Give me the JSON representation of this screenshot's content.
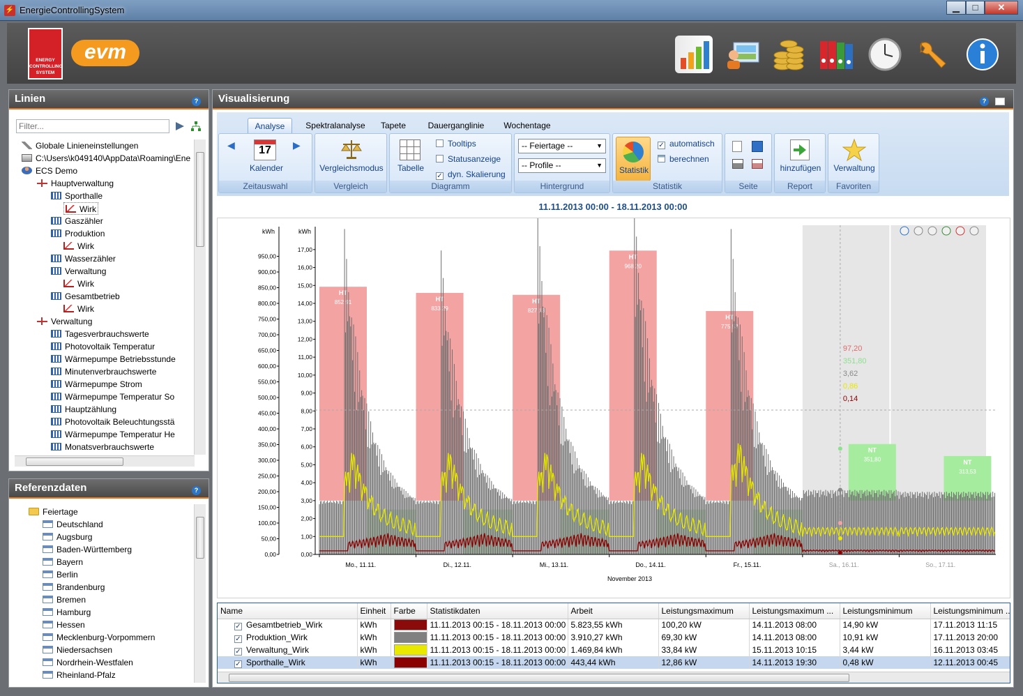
{
  "window": {
    "title": "EnergieControllingSystem",
    "btn_min": "▁",
    "btn_max": "□",
    "btn_close": "✕"
  },
  "header": {
    "ecs_logo": "ENERGY CONTROLLING SYSTEM",
    "evm_logo": "evm"
  },
  "lines_panel": {
    "title": "Linien",
    "filter_placeholder": "Filter...",
    "tree": [
      {
        "label": "Globale Linieneinstellungen",
        "icon": "wrench-icon",
        "level": 0
      },
      {
        "label": "C:\\Users\\k049140\\AppData\\Roaming\\Ene",
        "icon": "drive-icon",
        "level": 0
      },
      {
        "label": "ECS Demo",
        "icon": "user-icon",
        "level": 1
      },
      {
        "label": "Hauptverwaltung",
        "icon": "tree-icon",
        "level": 2
      },
      {
        "label": "Sporthalle",
        "icon": "meter-icon",
        "level": 3
      },
      {
        "label": "Wirk",
        "icon": "chart-icon",
        "level": 4
      },
      {
        "label": "Gaszähler",
        "icon": "meter-icon",
        "level": 3
      },
      {
        "label": "Produktion",
        "icon": "meter-icon",
        "level": 3
      },
      {
        "label": "Wirk",
        "icon": "chart-icon",
        "level": 4
      },
      {
        "label": "Wasserzähler",
        "icon": "meter-icon",
        "level": 3
      },
      {
        "label": "Verwaltung",
        "icon": "meter-icon",
        "level": 3
      },
      {
        "label": "Wirk",
        "icon": "chart-icon",
        "level": 4
      },
      {
        "label": "Gesamtbetrieb",
        "icon": "meter-icon",
        "level": 3
      },
      {
        "label": "Wirk",
        "icon": "chart-icon",
        "level": 4
      },
      {
        "label": "Verwaltung",
        "icon": "tree-icon",
        "level": 2
      },
      {
        "label": "Tagesverbrauchswerte",
        "icon": "meter-icon",
        "level": 3
      },
      {
        "label": "Photovoltaik Temperatur",
        "icon": "meter-icon",
        "level": 3
      },
      {
        "label": "Wärmepumpe Betriebsstunde",
        "icon": "meter-icon",
        "level": 3
      },
      {
        "label": "Minutenverbrauchswerte",
        "icon": "meter-icon",
        "level": 3
      },
      {
        "label": "Wärmepumpe Strom",
        "icon": "meter-icon",
        "level": 3
      },
      {
        "label": "Wärmepumpe Temperatur So",
        "icon": "meter-icon",
        "level": 3
      },
      {
        "label": "Hauptzählung",
        "icon": "meter-icon",
        "level": 3
      },
      {
        "label": "Photovoltaik Beleuchtungsstä",
        "icon": "meter-icon",
        "level": 3
      },
      {
        "label": "Wärmepumpe Temperatur He",
        "icon": "meter-icon",
        "level": 3
      },
      {
        "label": "Monatsverbrauchswerte",
        "icon": "meter-icon",
        "level": 3
      }
    ]
  },
  "ref_panel": {
    "title": "Referenzdaten",
    "tree": [
      {
        "label": "Feiertage",
        "icon": "folder-icon",
        "level": 0
      },
      {
        "label": "Deutschland",
        "icon": "calendar-icon",
        "level": 1
      },
      {
        "label": "Augsburg",
        "icon": "calendar-icon",
        "level": 1
      },
      {
        "label": "Baden-Württemberg",
        "icon": "calendar-icon",
        "level": 1
      },
      {
        "label": "Bayern",
        "icon": "calendar-icon",
        "level": 1
      },
      {
        "label": "Berlin",
        "icon": "calendar-icon",
        "level": 1
      },
      {
        "label": "Brandenburg",
        "icon": "calendar-icon",
        "level": 1
      },
      {
        "label": "Bremen",
        "icon": "calendar-icon",
        "level": 1
      },
      {
        "label": "Hamburg",
        "icon": "calendar-icon",
        "level": 1
      },
      {
        "label": "Hessen",
        "icon": "calendar-icon",
        "level": 1
      },
      {
        "label": "Mecklenburg-Vorpommern",
        "icon": "calendar-icon",
        "level": 1
      },
      {
        "label": "Niedersachsen",
        "icon": "calendar-icon",
        "level": 1
      },
      {
        "label": "Nordrhein-Westfalen",
        "icon": "calendar-icon",
        "level": 1
      },
      {
        "label": "Rheinland-Pfalz",
        "icon": "calendar-icon",
        "level": 1
      }
    ]
  },
  "vis": {
    "title": "Visualisierung",
    "tabs": [
      "Analyse",
      "Spektralanalyse",
      "Tapete",
      "Dauerganglinie",
      "Wochentage"
    ],
    "ribbon": {
      "zeitauswahl": {
        "label": "Zeitauswahl",
        "btn": "Kalender",
        "cal_day": "17"
      },
      "vergleich": {
        "label": "Vergleich",
        "btn": "Vergleichsmodus"
      },
      "diagramm": {
        "label": "Diagramm",
        "btn": "Tabelle",
        "tooltips": "Tooltips",
        "status": "Statusanzeige",
        "dyn": "dyn. Skalierung"
      },
      "hintergrund": {
        "label": "Hintergrund",
        "feiertage": "-- Feiertage --",
        "profile": "-- Profile --"
      },
      "statistik": {
        "label": "Statistik",
        "btn": "Statistik",
        "auto": "automatisch",
        "calc": "berechnen"
      },
      "seite": {
        "label": "Seite"
      },
      "report": {
        "label": "Report",
        "btn": "hinzufügen"
      },
      "favoriten": {
        "label": "Favoriten",
        "btn": "Verwaltung"
      }
    },
    "range": "11.11.2013 00:00 - 18.11.2013 00:00"
  },
  "chart_data": {
    "type": "bar",
    "ylabel_left": "kWh",
    "ylabel_right": "kWh",
    "y_left_ticks": [
      "0,00",
      "50,00",
      "100,00",
      "150,00",
      "200,00",
      "250,00",
      "300,00",
      "350,00",
      "400,00",
      "450,00",
      "500,00",
      "550,00",
      "600,00",
      "650,00",
      "700,00",
      "750,00",
      "800,00",
      "850,00",
      "900,00",
      "950,00"
    ],
    "y_right_ticks": [
      "0,00",
      "1,00",
      "2,00",
      "3,00",
      "4,00",
      "5,00",
      "6,00",
      "7,00",
      "8,00",
      "9,00",
      "10,00",
      "11,00",
      "12,00",
      "13,00",
      "14,00",
      "15,00",
      "16,00",
      "17,00"
    ],
    "ylim_left": [
      0,
      1000
    ],
    "ylim_right": [
      0,
      17.5
    ],
    "x_ticks": [
      "Mo., 11.11.",
      "Di., 12.11.",
      "Mi., 13.11.",
      "Do., 14.11.",
      "Fr., 15.11.",
      "Sa., 16.11.",
      "So., 17.11."
    ],
    "xlabel": "November 2013",
    "blocks": [
      {
        "label": "HT",
        "value": 852.91,
        "text": "852,91"
      },
      {
        "label": "HT",
        "value": 833.29,
        "text": "833,29"
      },
      {
        "label": "HT",
        "value": 827.13,
        "text": "827,13"
      },
      {
        "label": "HT",
        "value": 968.2,
        "text": "968,20"
      },
      {
        "label": "HT",
        "value": 775.53,
        "text": "775,53"
      },
      {
        "label": "NT",
        "value": 351.8,
        "text": "351,80"
      },
      {
        "label": "NT",
        "value": 313.53,
        "text": "313,53"
      }
    ],
    "day_peaks": [
      15.2,
      14.0,
      16.0,
      16.6,
      15.2,
      3.6,
      3.5
    ],
    "cursor_readout": [
      {
        "text": "97,20",
        "color": "#e06a6a"
      },
      {
        "text": "351,80",
        "color": "#8ee08e"
      },
      {
        "text": "3,62",
        "color": "#888888"
      },
      {
        "text": "0,86",
        "color": "#e8e800"
      },
      {
        "text": "0,14",
        "color": "#8b0000"
      }
    ],
    "colors": {
      "ht": "#f4a3a3",
      "nt": "#a6ec9f",
      "gray": "#6e6e6e",
      "yellow": "#e8e800",
      "darkred": "#8b0000",
      "weekend": "#e6e6e6"
    }
  },
  "stats": {
    "headers": [
      "Name",
      "Einheit",
      "Farbe",
      "Statistikdaten",
      "Arbeit",
      "Leistungsmaximum",
      "Leistungsmaximum ...",
      "Leistungsminimum",
      "Leistungsminimum ..."
    ],
    "rows": [
      {
        "name": "Gesamtbetrieb_Wirk",
        "unit": "kWh",
        "color": "#8b0a0a",
        "period": "11.11.2013 00:15 - 18.11.2013 00:00",
        "work": "5.823,55 kWh",
        "pmax": "100,20 kW",
        "pmax_t": "14.11.2013 08:00",
        "pmin": "14,90 kW",
        "pmin_t": "17.11.2013 11:15"
      },
      {
        "name": "Produktion_Wirk",
        "unit": "kWh",
        "color": "#808080",
        "period": "11.11.2013 00:15 - 18.11.2013 00:00",
        "work": "3.910,27 kWh",
        "pmax": "69,30 kW",
        "pmax_t": "14.11.2013 08:00",
        "pmin": "10,91 kW",
        "pmin_t": "17.11.2013 20:00"
      },
      {
        "name": "Verwaltung_Wirk",
        "unit": "kWh",
        "color": "#e8e800",
        "period": "11.11.2013 00:15 - 18.11.2013 00:00",
        "work": "1.469,84 kWh",
        "pmax": "33,84 kW",
        "pmax_t": "15.11.2013 10:15",
        "pmin": "3,44 kW",
        "pmin_t": "16.11.2013 03:45"
      },
      {
        "name": "Sporthalle_Wirk",
        "unit": "kWh",
        "color": "#8b0000",
        "period": "11.11.2013 00:15 - 18.11.2013 00:00",
        "work": "443,44 kWh",
        "pmax": "12,86 kW",
        "pmax_t": "14.11.2013 19:30",
        "pmin": "0,48 kW",
        "pmin_t": "12.11.2013 00:45"
      }
    ]
  }
}
